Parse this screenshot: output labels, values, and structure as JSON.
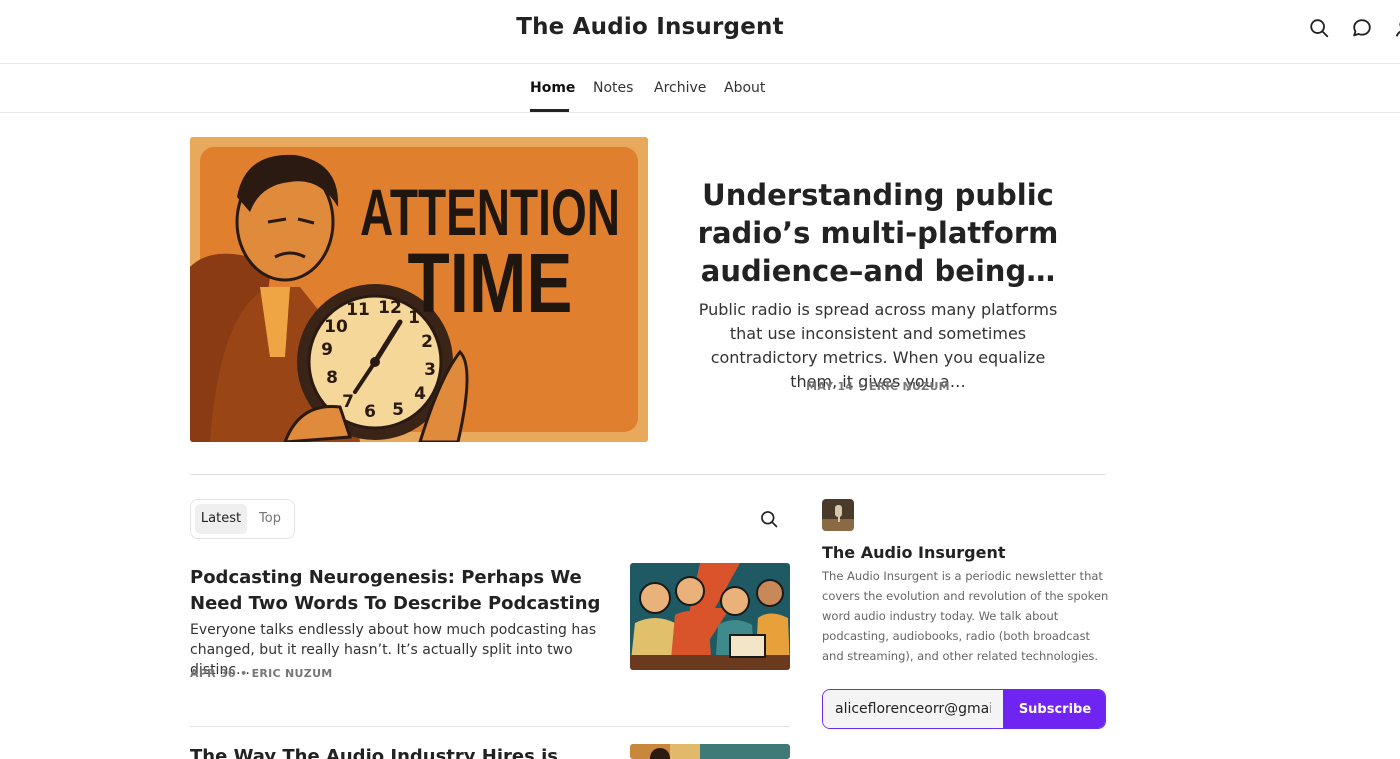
{
  "site": {
    "title": "The Audio Insurgent"
  },
  "header": {
    "icons": [
      "search-icon",
      "chat-icon"
    ]
  },
  "nav": {
    "items": [
      {
        "label": "Home"
      },
      {
        "label": "Notes"
      },
      {
        "label": "Archive"
      },
      {
        "label": "About"
      }
    ],
    "active": "Home"
  },
  "hero": {
    "image_text_line1": "ATTENTION",
    "image_text_line2": "TIME",
    "title": "Understanding public radio’s multi-platform audience–and being…",
    "subtitle": "Public radio is spread across many platforms that use inconsistent and sometimes contradictory metrics. When you equalize them, it gives you a…",
    "meta": "MAY 14 • ERIC NUZUM"
  },
  "tabs": {
    "latest": "Latest",
    "top": "Top",
    "active": "Latest"
  },
  "posts": [
    {
      "title": "Podcasting Neurogenesis: Perhaps We Need Two Words To Describe Podcasting",
      "description": "Everyone talks endlessly about how much podcasting has changed, but it really hasn’t. It’s actually split into two distinc…",
      "meta": "APR 30 • ERIC NUZUM"
    },
    {
      "title": "The Way The Audio Industry Hires is"
    }
  ],
  "sidebar": {
    "title": "The Audio Insurgent",
    "description": "The Audio Insurgent is a periodic newsletter that covers the evolution and revolution of the spoken word audio industry today. We talk about podcasting, audiobooks, radio (both broadcast and streaming), and other related technologies.",
    "email_value": "aliceflorenceorr@gmail.com",
    "subscribe_label": "Subscribe"
  },
  "colors": {
    "accent": "#6f24f2",
    "hero_orange": "#e08a3c"
  }
}
